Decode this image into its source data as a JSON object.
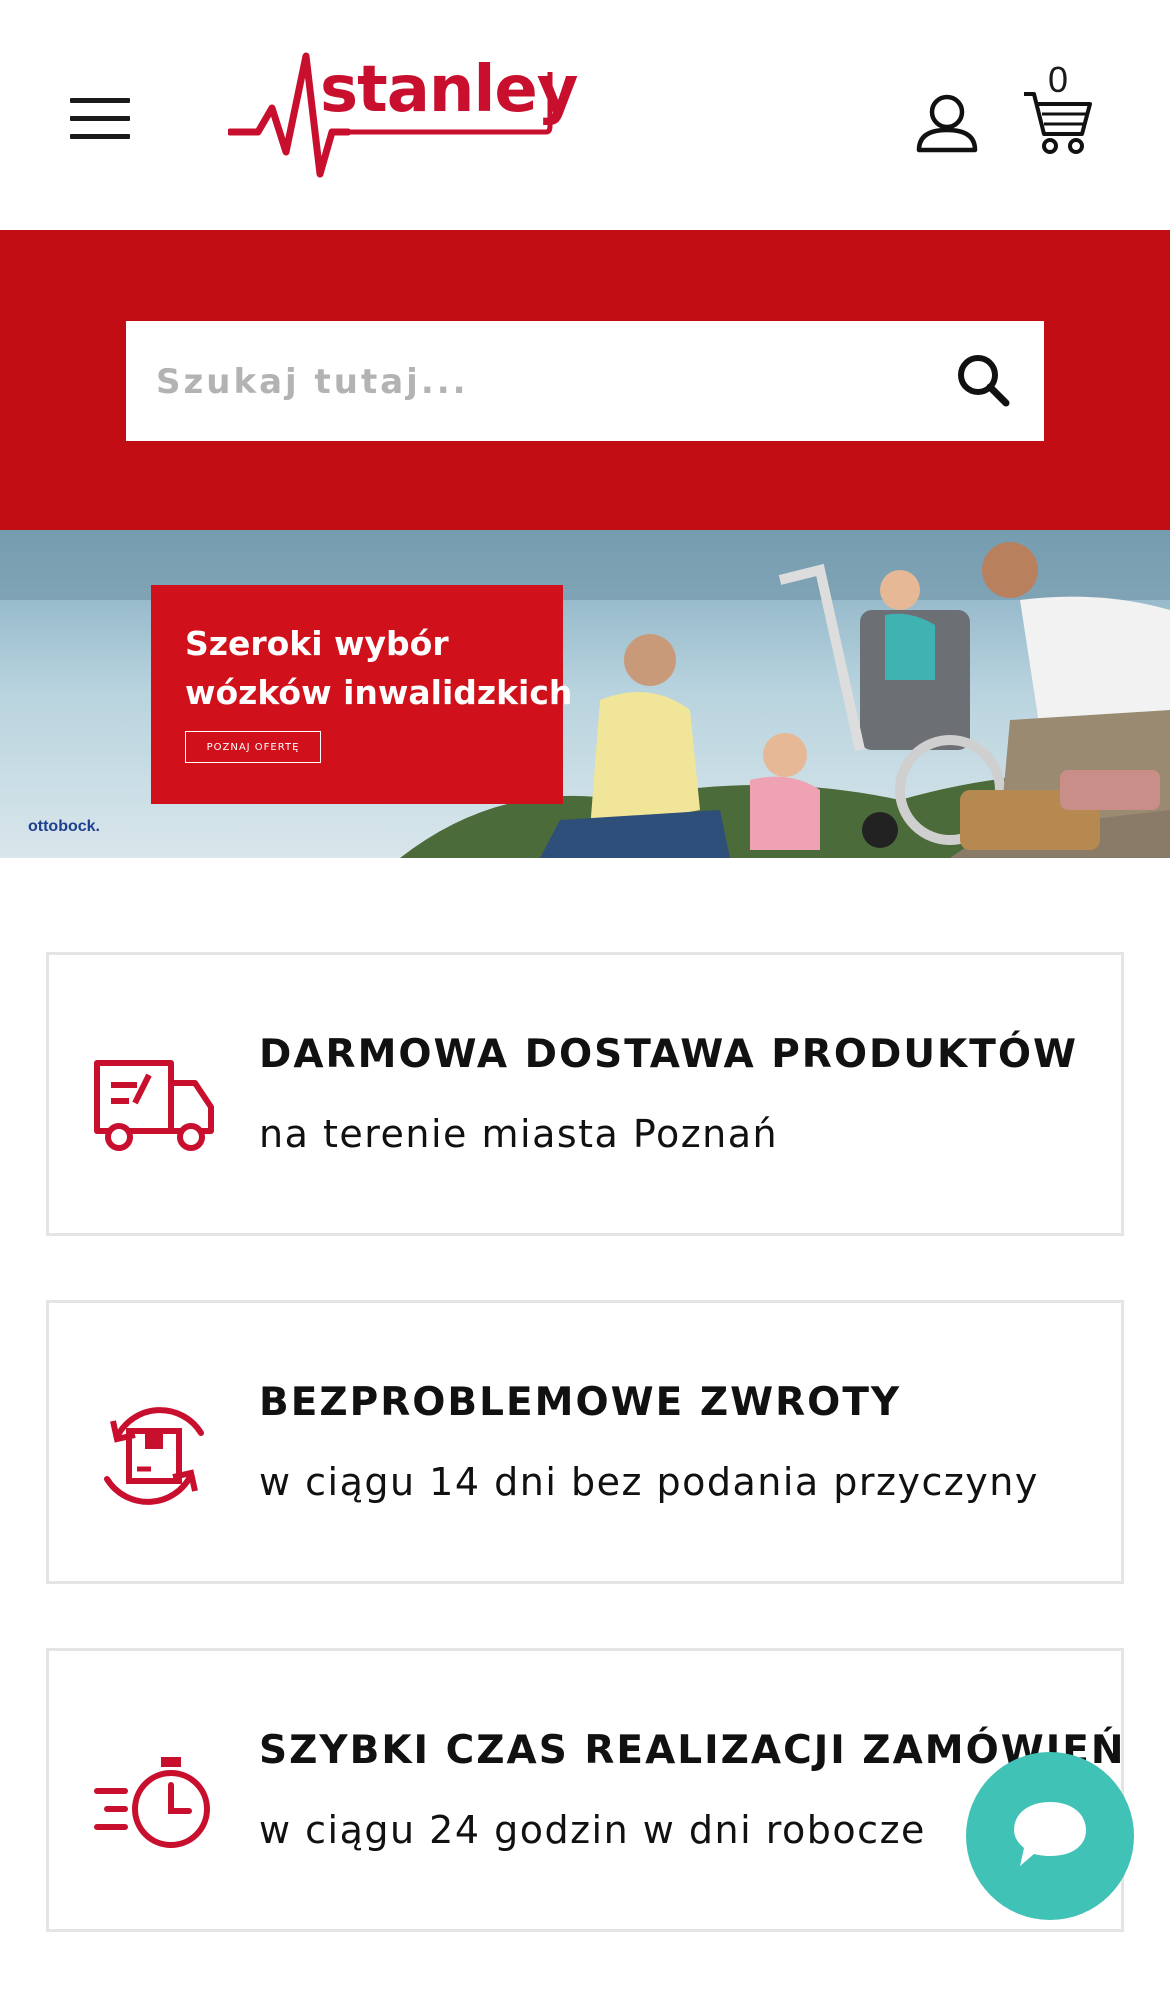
{
  "header": {
    "menu_icon": "hamburger-menu-icon",
    "logo_text": "stanley",
    "account_icon": "user-icon",
    "cart_icon": "cart-icon",
    "cart_count": "0"
  },
  "search": {
    "placeholder": "Szukaj tutaj...",
    "value": "",
    "button_icon": "search-icon"
  },
  "banner": {
    "promo_line_1": "Szeroki wybór",
    "promo_line_2": "wózków inwalidzkich",
    "promo_button": "POZNAJ OFERTĘ",
    "brand": "ottobock."
  },
  "features": [
    {
      "icon": "delivery-truck-icon",
      "title": "DARMOWA DOSTAWA PRODUKTÓW",
      "subtitle": "na terenie miasta Poznań"
    },
    {
      "icon": "returns-box-icon",
      "title": "BEZPROBLEMOWE ZWROTY",
      "subtitle": "w ciągu 14 dni bez podania przyczyny"
    },
    {
      "icon": "stopwatch-icon",
      "title": "SZYBKI CZAS REALIZACJI ZAMÓWIEŃ",
      "subtitle": "w ciągu 24 godzin w dni robocze"
    }
  ],
  "chat": {
    "icon": "chat-bubble-icon"
  },
  "colors": {
    "brand_red": "#c30d14",
    "accent_red": "#d0111b",
    "chat_teal": "#41c2b6"
  }
}
